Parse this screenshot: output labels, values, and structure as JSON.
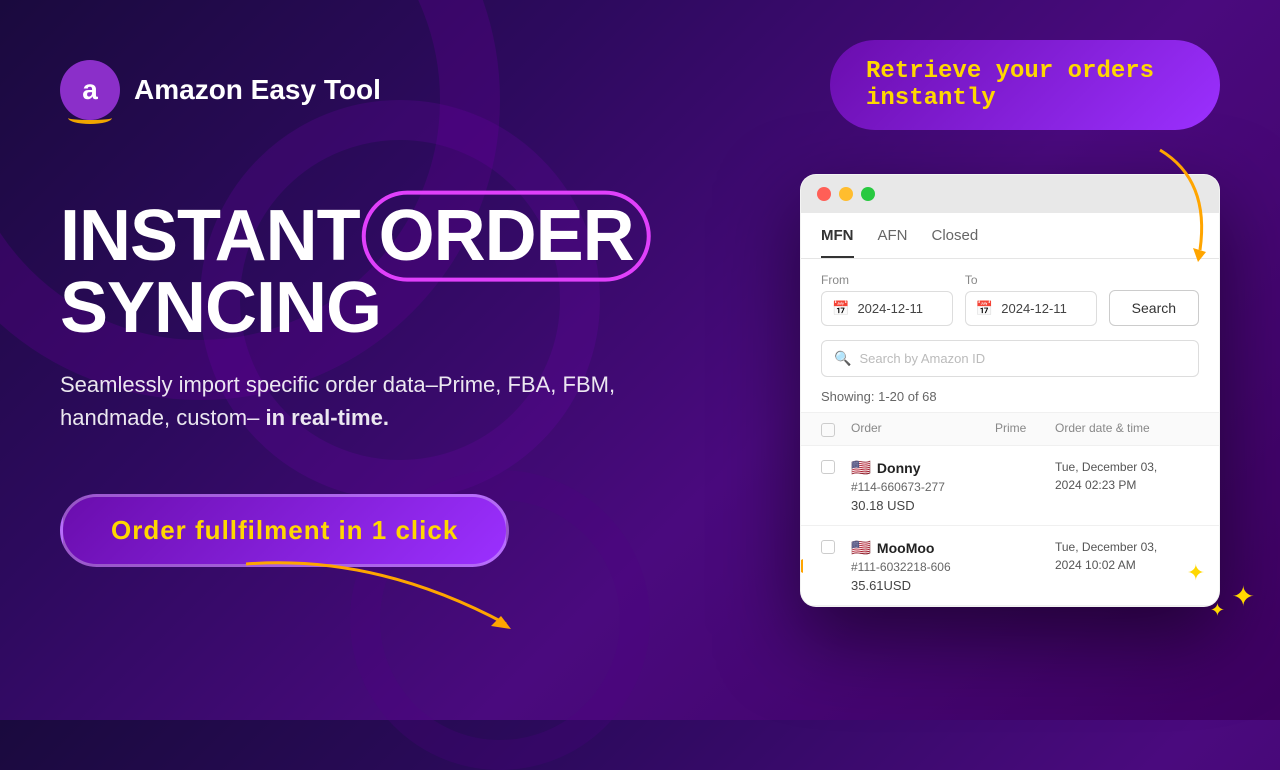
{
  "app": {
    "logo_letter": "a",
    "name": "Amazon Easy Tool"
  },
  "headline": {
    "line1": "INSTANT ORDER",
    "order_word": "ORDER",
    "line2": "SYNCING",
    "instant": "INSTANT",
    "syncing": "SYNCING"
  },
  "subtitle": {
    "text": "Seamlessly import specific order data–Prime, FBA, FBM, handmade, custom–",
    "bold_part": "in real-time."
  },
  "cta": {
    "label": "Order fullfilment  in 1 click"
  },
  "callout": {
    "text": "Retrieve your orders instantly"
  },
  "window": {
    "tabs": [
      {
        "label": "MFN",
        "active": true
      },
      {
        "label": "AFN",
        "active": false
      },
      {
        "label": "Closed",
        "active": false
      }
    ],
    "from_label": "From",
    "to_label": "To",
    "from_date": "2024-12-11",
    "to_date": "2024-12-11",
    "search_button": "Search",
    "search_placeholder": "Search by Amazon ID",
    "showing_text": "Showing: 1-20 of 68",
    "columns": {
      "order": "Order",
      "prime": "Prime",
      "date": "Order date & time"
    },
    "orders": [
      {
        "flag": "🇺🇸",
        "buyer": "Donny",
        "order_id": "#114-660673-277",
        "amount": "30.18 USD",
        "date": "Tue, December 03,\n2024  02:23 PM"
      },
      {
        "flag": "🇺🇸",
        "buyer": "MooMoo",
        "order_id": "#111-6032218-606",
        "amount": "35.61USD",
        "date": "Tue, December 03,\n2024  10:02 AM"
      }
    ]
  }
}
